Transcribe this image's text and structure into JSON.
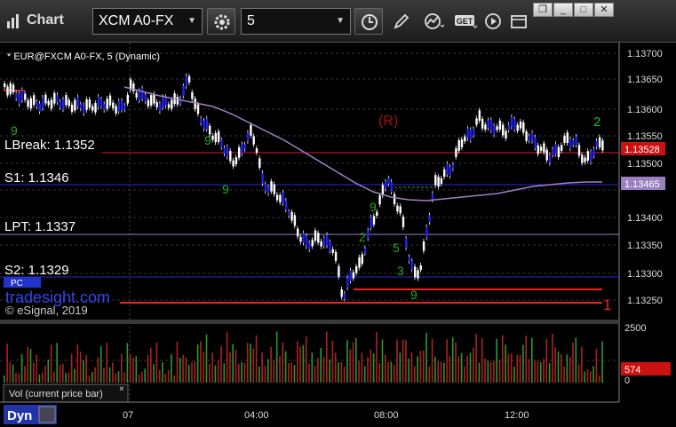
{
  "app": {
    "title": "Chart"
  },
  "toolbar": {
    "symbol": "XCM A0-FX",
    "interval": "5",
    "buttons": [
      "settings-icon",
      "clock-icon",
      "pen-icon",
      "study-icon",
      "get-icon",
      "play-icon",
      "window-icon"
    ],
    "get_label": "GET"
  },
  "window_controls": [
    "restore",
    "minimize",
    "maximize",
    "close"
  ],
  "chart": {
    "header": "* EUR@FXCM A0-FX, 5 (Dynamic)",
    "watermark": "tradesight.com",
    "copyright": "© eSignal, 2019",
    "price_labels": [
      "1.13700",
      "1.13650",
      "1.13600",
      "1.13550",
      "1.13500",
      "1.13450",
      "1.13400",
      "1.13350",
      "1.13300",
      "1.13250"
    ],
    "current_price": "1.13528",
    "ma_price": "1.13465",
    "levels": [
      {
        "label": "LBreak: 1.1352",
        "color": "#cc2222"
      },
      {
        "label": "S1: 1.1346",
        "color": "#3333cc"
      },
      {
        "label": "LPT: 1.1337",
        "color": "#aa88cc"
      },
      {
        "label": "S2: 1.1329",
        "color": "#3333cc"
      }
    ],
    "annotations": [
      "(R)",
      "2",
      "9",
      "1",
      "9",
      "9",
      "9",
      "9",
      "2",
      "5",
      "3"
    ],
    "vol_labels": [
      "2500",
      "0"
    ],
    "vol_current": "574",
    "vol_caption": "Vol (current price bar)",
    "time_labels": [
      "07",
      "04:00",
      "08:00",
      "12:00"
    ],
    "dyn_label": "Dyn",
    "pc_label": "PC"
  },
  "colors": {
    "up_bar": "#ffffff",
    "down_bar": "#2222ee",
    "ma_line": "#a080c8",
    "lbreak": "#cc2222",
    "support": "#3333cc",
    "vol_up": "#2a9a2a",
    "vol_down": "#aa2222"
  }
}
